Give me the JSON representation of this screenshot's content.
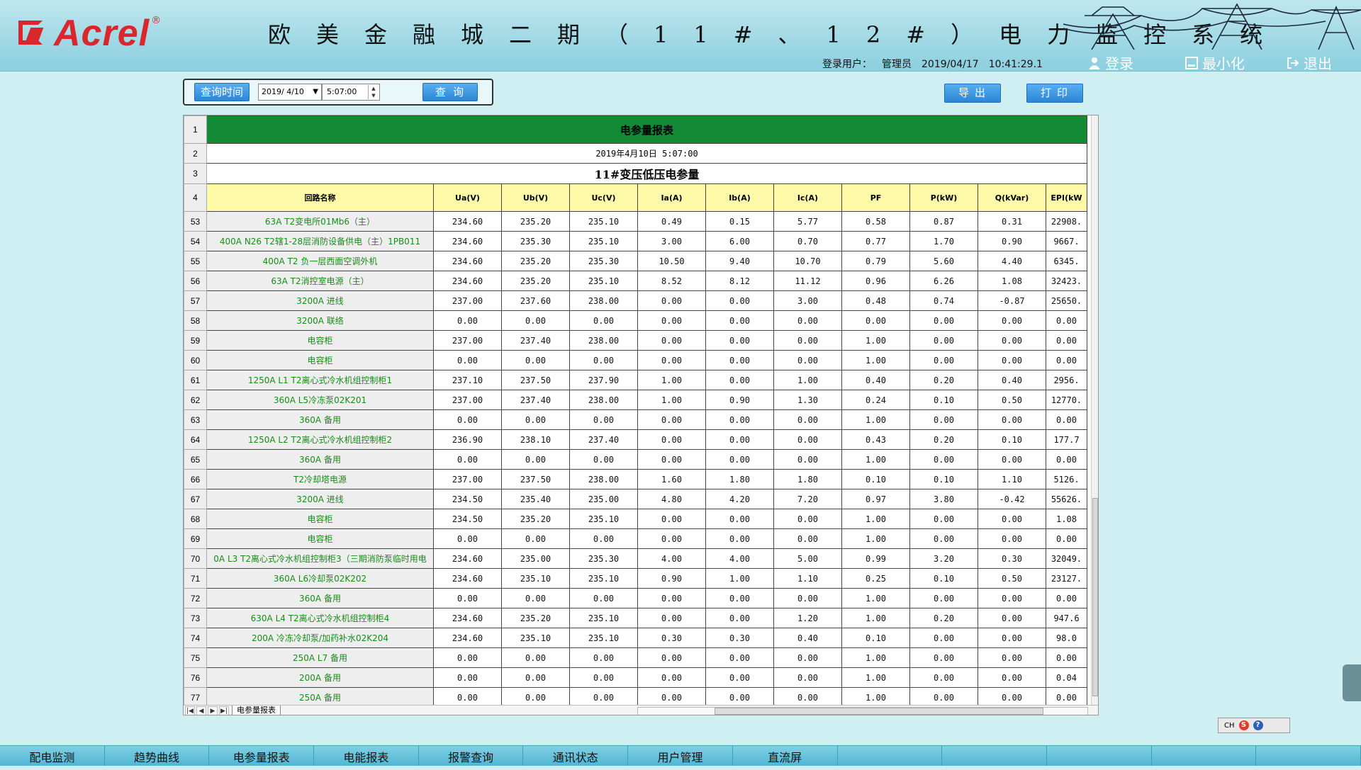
{
  "header": {
    "logo_text": "Acrel",
    "logo_reg": "®",
    "title": "欧美金融城二期（11#、12#）电力监控系统",
    "user_label": "登录用户：",
    "user_name": "管理员",
    "date": "2019/04/17",
    "time": "10:41:29.1",
    "login_label": "登录",
    "minimize_label": "最小化",
    "exit_label": "退出"
  },
  "query": {
    "time_button": "查询时间",
    "date_value": "2019/ 4/10",
    "time_value": "5:07:00",
    "query_button": "查询"
  },
  "actions": {
    "export_label": "导出",
    "print_label": "打印"
  },
  "report": {
    "title_row_no": "1",
    "title": "电参量报表",
    "date_row_no": "2",
    "date": "2019年4月10日 5:07:00",
    "subtitle_row_no": "3",
    "subtitle": "11#变压低压电参量",
    "header_row_no": "4",
    "columns": [
      "回路名称",
      "Ua(V)",
      "Ub(V)",
      "Uc(V)",
      "Ia(A)",
      "Ib(A)",
      "Ic(A)",
      "PF",
      "P(kW)",
      "Q(kVar)",
      "EPI(kW"
    ],
    "rows": [
      [
        "53",
        "63A T2变电所01Mb6（主）",
        "234.60",
        "235.20",
        "235.10",
        "0.49",
        "0.15",
        "5.77",
        "0.58",
        "0.87",
        "0.31",
        "22908."
      ],
      [
        "54",
        "400A N26 T2辖1-28层消防设备供电（主）1PB011",
        "234.60",
        "235.30",
        "235.10",
        "3.00",
        "6.00",
        "0.70",
        "0.77",
        "1.70",
        "0.90",
        "9667."
      ],
      [
        "55",
        "400A T2 负一层西面空调外机",
        "234.60",
        "235.20",
        "235.30",
        "10.50",
        "9.40",
        "10.70",
        "0.79",
        "5.60",
        "4.40",
        "6345."
      ],
      [
        "56",
        "63A T2消控室电源（主）",
        "234.60",
        "235.20",
        "235.10",
        "8.52",
        "8.12",
        "11.12",
        "0.96",
        "6.26",
        "1.08",
        "32423."
      ],
      [
        "57",
        "3200A 进线",
        "237.00",
        "237.60",
        "238.00",
        "0.00",
        "0.00",
        "3.00",
        "0.48",
        "0.74",
        "-0.87",
        "25650."
      ],
      [
        "58",
        "3200A 联络",
        "0.00",
        "0.00",
        "0.00",
        "0.00",
        "0.00",
        "0.00",
        "0.00",
        "0.00",
        "0.00",
        "0.00"
      ],
      [
        "59",
        "电容柜",
        "237.00",
        "237.40",
        "238.00",
        "0.00",
        "0.00",
        "0.00",
        "1.00",
        "0.00",
        "0.00",
        "0.00"
      ],
      [
        "60",
        "电容柜",
        "0.00",
        "0.00",
        "0.00",
        "0.00",
        "0.00",
        "0.00",
        "1.00",
        "0.00",
        "0.00",
        "0.00"
      ],
      [
        "61",
        "1250A L1 T2离心式冷水机组控制柜1",
        "237.10",
        "237.50",
        "237.90",
        "1.00",
        "0.00",
        "1.00",
        "0.40",
        "0.20",
        "0.40",
        "2956."
      ],
      [
        "62",
        "360A L5冷冻泵02K201",
        "237.00",
        "237.40",
        "238.00",
        "1.00",
        "0.90",
        "1.30",
        "0.24",
        "0.10",
        "0.50",
        "12770."
      ],
      [
        "63",
        "360A 备用",
        "0.00",
        "0.00",
        "0.00",
        "0.00",
        "0.00",
        "0.00",
        "1.00",
        "0.00",
        "0.00",
        "0.00"
      ],
      [
        "64",
        "1250A L2 T2离心式冷水机组控制柜2",
        "236.90",
        "238.10",
        "237.40",
        "0.00",
        "0.00",
        "0.00",
        "0.43",
        "0.20",
        "0.10",
        "177.7"
      ],
      [
        "65",
        "360A 备用",
        "0.00",
        "0.00",
        "0.00",
        "0.00",
        "0.00",
        "0.00",
        "1.00",
        "0.00",
        "0.00",
        "0.00"
      ],
      [
        "66",
        "T2冷却塔电源",
        "237.00",
        "237.50",
        "238.00",
        "1.60",
        "1.80",
        "1.80",
        "0.10",
        "0.10",
        "1.10",
        "5126."
      ],
      [
        "67",
        "3200A 进线",
        "234.50",
        "235.40",
        "235.00",
        "4.80",
        "4.20",
        "7.20",
        "0.97",
        "3.80",
        "-0.42",
        "55626."
      ],
      [
        "68",
        "电容柜",
        "234.50",
        "235.20",
        "235.10",
        "0.00",
        "0.00",
        "0.00",
        "1.00",
        "0.00",
        "0.00",
        "1.08"
      ],
      [
        "69",
        "电容柜",
        "0.00",
        "0.00",
        "0.00",
        "0.00",
        "0.00",
        "0.00",
        "1.00",
        "0.00",
        "0.00",
        "0.00"
      ],
      [
        "70",
        "0A L3 T2离心式冷水机组控制柜3（三期消防泵临时用电",
        "234.60",
        "235.00",
        "235.30",
        "4.00",
        "4.00",
        "5.00",
        "0.99",
        "3.20",
        "0.30",
        "32049."
      ],
      [
        "71",
        "360A L6冷却泵02K202",
        "234.60",
        "235.10",
        "235.10",
        "0.90",
        "1.00",
        "1.10",
        "0.25",
        "0.10",
        "0.50",
        "23127."
      ],
      [
        "72",
        "360A 备用",
        "0.00",
        "0.00",
        "0.00",
        "0.00",
        "0.00",
        "0.00",
        "1.00",
        "0.00",
        "0.00",
        "0.00"
      ],
      [
        "73",
        "630A L4 T2离心式冷水机组控制柜4",
        "234.60",
        "235.20",
        "235.10",
        "0.00",
        "0.00",
        "1.20",
        "1.00",
        "0.20",
        "0.00",
        "947.6"
      ],
      [
        "74",
        "200A 冷冻冷却泵/加药补水02K204",
        "234.60",
        "235.10",
        "235.10",
        "0.30",
        "0.30",
        "0.40",
        "0.10",
        "0.00",
        "0.00",
        "98.0"
      ],
      [
        "75",
        "250A L7 备用",
        "0.00",
        "0.00",
        "0.00",
        "0.00",
        "0.00",
        "0.00",
        "1.00",
        "0.00",
        "0.00",
        "0.00"
      ],
      [
        "76",
        "200A 备用",
        "0.00",
        "0.00",
        "0.00",
        "0.00",
        "0.00",
        "0.00",
        "1.00",
        "0.00",
        "0.00",
        "0.04"
      ],
      [
        "77",
        "250A 备用",
        "0.00",
        "0.00",
        "0.00",
        "0.00",
        "0.00",
        "0.00",
        "1.00",
        "0.00",
        "0.00",
        "0.00"
      ]
    ],
    "sheet_tab": "电参量报表"
  },
  "tray": {
    "label": "CH",
    "s": "S",
    "q": "?"
  },
  "nav": [
    "配电监测",
    "趋势曲线",
    "电参量报表",
    "电能报表",
    "报警查询",
    "通讯状态",
    "用户管理",
    "直流屏",
    "",
    "",
    "",
    "",
    ""
  ],
  "colors": {
    "title_green": "#138a36",
    "header_yellow": "#fffaa8",
    "name_green": "#1a8a1a",
    "brand_red": "#d9272e"
  }
}
